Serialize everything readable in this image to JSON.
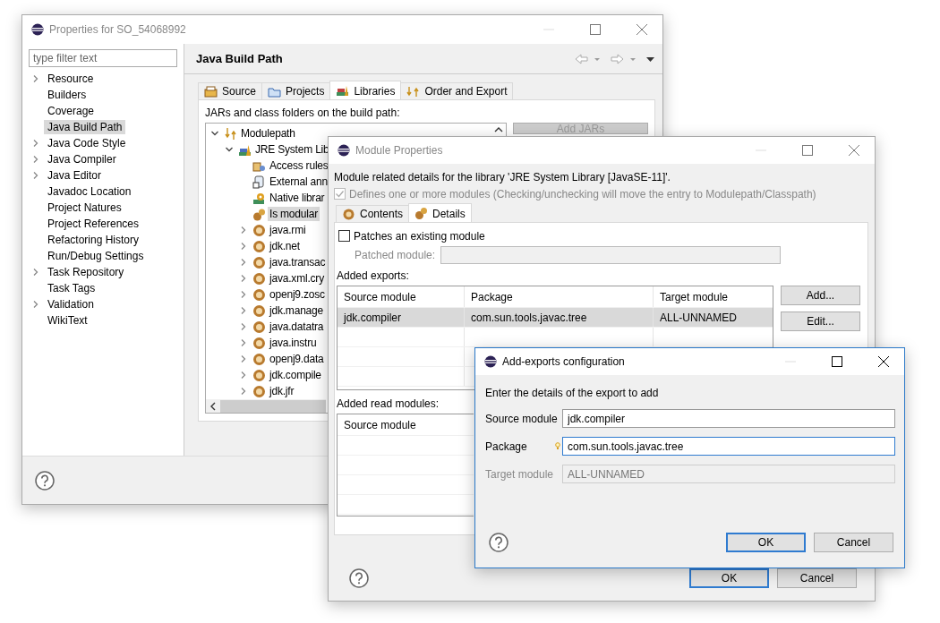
{
  "properties_window": {
    "title": "Properties for SO_54068992",
    "filter": {
      "placeholder": "type filter text"
    },
    "nav_items": [
      {
        "label": "Resource",
        "expandable": true,
        "selected": false
      },
      {
        "label": "Builders",
        "expandable": false,
        "selected": false
      },
      {
        "label": "Coverage",
        "expandable": false,
        "selected": false
      },
      {
        "label": "Java Build Path",
        "expandable": false,
        "selected": true
      },
      {
        "label": "Java Code Style",
        "expandable": true,
        "selected": false
      },
      {
        "label": "Java Compiler",
        "expandable": true,
        "selected": false
      },
      {
        "label": "Java Editor",
        "expandable": true,
        "selected": false
      },
      {
        "label": "Javadoc Location",
        "expandable": false,
        "selected": false
      },
      {
        "label": "Project Natures",
        "expandable": false,
        "selected": false
      },
      {
        "label": "Project References",
        "expandable": false,
        "selected": false
      },
      {
        "label": "Refactoring History",
        "expandable": false,
        "selected": false
      },
      {
        "label": "Run/Debug Settings",
        "expandable": false,
        "selected": false
      },
      {
        "label": "Task Repository",
        "expandable": true,
        "selected": false
      },
      {
        "label": "Task Tags",
        "expandable": false,
        "selected": false
      },
      {
        "label": "Validation",
        "expandable": true,
        "selected": false
      },
      {
        "label": "WikiText",
        "expandable": false,
        "selected": false
      }
    ],
    "page_title": "Java Build Path",
    "tabs": [
      {
        "label": "Source",
        "kind": "source",
        "selected": false
      },
      {
        "label": "Projects",
        "kind": "projects",
        "selected": false
      },
      {
        "label": "Libraries",
        "kind": "libraries",
        "selected": true
      },
      {
        "label": "Order and Export",
        "kind": "order",
        "selected": false
      }
    ],
    "caption": "JARs and class folders on the build path:",
    "tree": [
      {
        "label": "Modulepath",
        "kind": "modulepath",
        "expandable": true,
        "expanded": true,
        "selected": false,
        "children": [
          {
            "label": "JRE System Lib",
            "kind": "library",
            "expandable": true,
            "expanded": true,
            "selected": false,
            "children": [
              {
                "label": "Access rules",
                "kind": "access",
                "expandable": false,
                "selected": false
              },
              {
                "label": "External ann",
                "kind": "annotation",
                "expandable": false,
                "selected": false
              },
              {
                "label": "Native librar",
                "kind": "native",
                "expandable": false,
                "selected": false
              },
              {
                "label": "Is modular",
                "kind": "modular",
                "expandable": false,
                "selected": true
              },
              {
                "label": "java.rmi",
                "kind": "module",
                "expandable": true,
                "expanded": false,
                "selected": false
              },
              {
                "label": "jdk.net",
                "kind": "module",
                "expandable": true,
                "expanded": false,
                "selected": false
              },
              {
                "label": "java.transac",
                "kind": "module",
                "expandable": true,
                "expanded": false,
                "selected": false
              },
              {
                "label": "java.xml.cry",
                "kind": "module",
                "expandable": true,
                "expanded": false,
                "selected": false
              },
              {
                "label": "openj9.zosc",
                "kind": "module",
                "expandable": true,
                "expanded": false,
                "selected": false
              },
              {
                "label": "jdk.manage",
                "kind": "module",
                "expandable": true,
                "expanded": false,
                "selected": false
              },
              {
                "label": "java.datatra",
                "kind": "module",
                "expandable": true,
                "expanded": false,
                "selected": false
              },
              {
                "label": "java.instru",
                "kind": "module",
                "expandable": true,
                "expanded": false,
                "selected": false
              },
              {
                "label": "openj9.data",
                "kind": "module",
                "expandable": true,
                "expanded": false,
                "selected": false
              },
              {
                "label": "jdk.compile",
                "kind": "module",
                "expandable": true,
                "expanded": false,
                "selected": false
              },
              {
                "label": "jdk.jfr",
                "kind": "module",
                "expandable": true,
                "expanded": false,
                "selected": false
              }
            ]
          }
        ]
      }
    ],
    "add_jars_button": "Add JARs"
  },
  "module_properties": {
    "title": "Module Properties",
    "description": "Module related details for the library 'JRE System Library [JavaSE-11]'.",
    "defines_modules": {
      "label": "Defines one or more modules (Checking/unchecking will move the entry to Modulepath/Classpath)",
      "checked": true,
      "disabled": true
    },
    "tabs": [
      {
        "label": "Contents",
        "kind": "contents",
        "selected": false
      },
      {
        "label": "Details",
        "kind": "details",
        "selected": true
      }
    ],
    "patches": {
      "label": "Patches an existing module",
      "checked": false
    },
    "patched_module_label": "Patched module:",
    "exports_label": "Added exports:",
    "exports_table": {
      "columns": [
        "Source module",
        "Package",
        "Target module"
      ],
      "rows": [
        {
          "cells": [
            "jdk.compiler",
            "com.sun.tools.javac.tree",
            "ALL-UNNAMED"
          ],
          "selected": true
        }
      ]
    },
    "side_buttons": [
      "Add...",
      "Edit..."
    ],
    "read_label": "Added read modules:",
    "read_table": {
      "columns": [
        "Source module"
      ]
    },
    "buttons": [
      {
        "label": "OK",
        "default": true
      },
      {
        "label": "Cancel",
        "default": false
      }
    ]
  },
  "add_exports": {
    "title": "Add-exports configuration",
    "instruction": "Enter the details of the export to add",
    "fields": [
      {
        "label": "Source module",
        "value": "jdk.compiler",
        "focused": false,
        "disabled": false
      },
      {
        "label": "Package",
        "value": "com.sun.tools.javac.tree",
        "focused": true,
        "disabled": false
      },
      {
        "label": "Target module",
        "value": "ALL-UNNAMED",
        "focused": false,
        "disabled": true
      }
    ],
    "buttons": [
      {
        "label": "OK",
        "default": true
      },
      {
        "label": "Cancel",
        "default": false
      }
    ]
  }
}
